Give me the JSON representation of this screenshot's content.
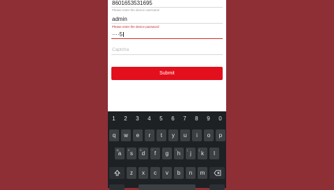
{
  "form": {
    "device_id_value": "8601653531695",
    "device_id_hint": "Please enter the device username",
    "username_value": "admin",
    "password_hint": "Please enter the device password",
    "password_value": "····5",
    "captcha_placeholder": "Captcha",
    "submit_label": "Submit"
  },
  "keyboard": {
    "numbers": [
      "1",
      "2",
      "3",
      "4",
      "5",
      "6",
      "7",
      "8",
      "9",
      "0"
    ],
    "row1": [
      "q",
      "w",
      "e",
      "r",
      "t",
      "y",
      "u",
      "i",
      "o",
      "p"
    ],
    "row2": [
      "a",
      "s",
      "d",
      "f",
      "g",
      "h",
      "j",
      "k",
      "l"
    ],
    "row2_sub": [
      "@",
      "#",
      "&",
      "*",
      "-",
      "+",
      "(",
      ")",
      ""
    ],
    "row3": [
      "z",
      "x",
      "c",
      "v",
      "b",
      "n",
      "m"
    ],
    "shift_icon": "shift-icon",
    "backspace_icon": "backspace-icon"
  },
  "colors": {
    "background": "#8e2f36",
    "accent": "#e30f1c",
    "error_text": "#c62828",
    "keyboard_bg": "#1e2124",
    "key_bg": "#3c4043"
  }
}
